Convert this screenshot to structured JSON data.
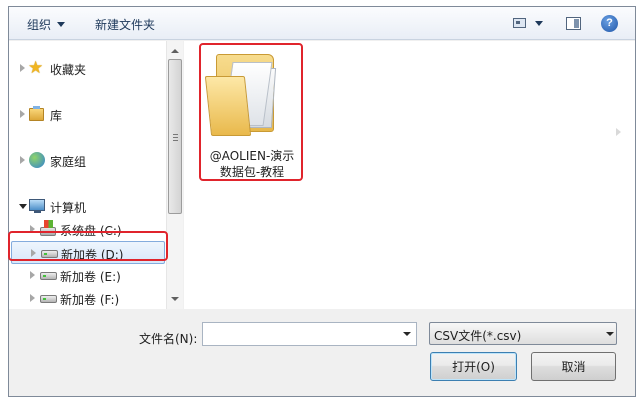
{
  "toolbar": {
    "organize": "组织",
    "new_folder": "新建文件夹"
  },
  "nav": {
    "favorites": "收藏夹",
    "libraries": "库",
    "homegroup": "家庭组",
    "computer": "计算机",
    "drives": [
      {
        "label": "系统盘 (C:)"
      },
      {
        "label": "新加卷 (D:)"
      },
      {
        "label": "新加卷 (E:)"
      },
      {
        "label": "新加卷 (F:)"
      }
    ],
    "selected": "新加卷 (D:)"
  },
  "content": {
    "items": [
      {
        "name_line1": "@AOLIEN-演示",
        "name_line2": "数据包-教程",
        "type": "folder"
      }
    ]
  },
  "bottom": {
    "filename_label": "文件名(N):",
    "filename_value": "",
    "filter_value": "CSV文件(*.csv)",
    "open_button": "打开(O)",
    "cancel_button": "取消"
  },
  "colors": {
    "highlight": "#e0242c",
    "selection": "#d8e8fa",
    "toolbar_text": "#1e395b"
  }
}
